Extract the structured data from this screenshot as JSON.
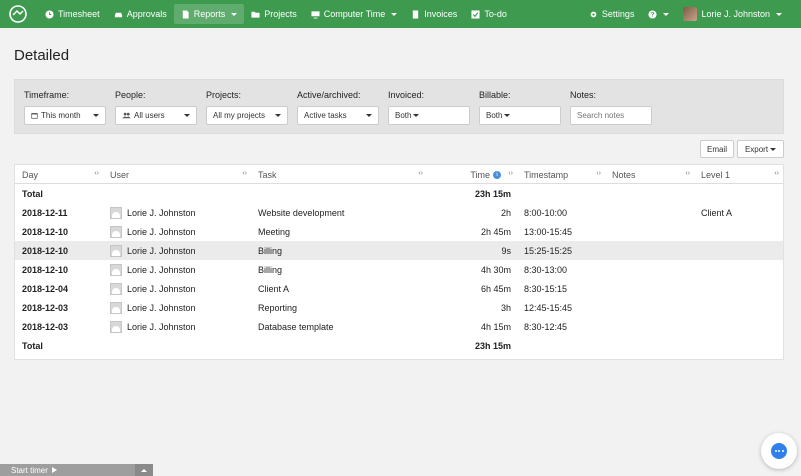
{
  "nav": {
    "items": [
      {
        "label": "Timesheet",
        "icon": "clock-icon"
      },
      {
        "label": "Approvals",
        "icon": "car-icon"
      },
      {
        "label": "Reports",
        "icon": "document-icon"
      },
      {
        "label": "Projects",
        "icon": "folder-icon"
      },
      {
        "label": "Computer Time",
        "icon": "monitor-icon"
      },
      {
        "label": "Invoices",
        "icon": "invoice-icon"
      },
      {
        "label": "To-do",
        "icon": "checkbox-icon"
      }
    ],
    "settings": "Settings",
    "help_icon": "question-icon",
    "user": "Lorie J. Johnston",
    "colors": {
      "bar": "#3d9a4f"
    }
  },
  "page": {
    "title": "Detailed"
  },
  "filters": {
    "timeframe": {
      "label": "Timeframe:",
      "value": "This month"
    },
    "people": {
      "label": "People:",
      "value": "All users"
    },
    "projects": {
      "label": "Projects:",
      "value": "All my projects"
    },
    "active": {
      "label": "Active/archived:",
      "value": "Active tasks"
    },
    "invoiced": {
      "label": "Invoiced:",
      "value": "Both"
    },
    "billable": {
      "label": "Billable:",
      "value": "Both"
    },
    "notes": {
      "label": "Notes:",
      "placeholder": "Search notes"
    }
  },
  "actions": {
    "email": "Email",
    "export": "Export"
  },
  "table": {
    "headers": {
      "day": "Day",
      "user": "User",
      "task": "Task",
      "time": "Time",
      "timestamp": "Timestamp",
      "notes": "Notes",
      "level1": "Level 1"
    },
    "total_label": "Total",
    "total_time": "23h 15m",
    "rows": [
      {
        "day": "2018-12-11",
        "user": "Lorie J. Johnston",
        "task": "Website development",
        "time": "2h",
        "timestamp": "8:00-10:00",
        "notes": "",
        "level1": "Client A"
      },
      {
        "day": "2018-12-10",
        "user": "Lorie J. Johnston",
        "task": "Meeting",
        "time": "2h 45m",
        "timestamp": "13:00-15:45",
        "notes": "",
        "level1": ""
      },
      {
        "day": "2018-12-10",
        "user": "Lorie J. Johnston",
        "task": "Billing",
        "time": "9s",
        "timestamp": "15:25-15:25",
        "notes": "",
        "level1": ""
      },
      {
        "day": "2018-12-10",
        "user": "Lorie J. Johnston",
        "task": "Billing",
        "time": "4h 30m",
        "timestamp": "8:30-13:00",
        "notes": "",
        "level1": ""
      },
      {
        "day": "2018-12-04",
        "user": "Lorie J. Johnston",
        "task": "Client A",
        "time": "6h 45m",
        "timestamp": "8:30-15:15",
        "notes": "",
        "level1": ""
      },
      {
        "day": "2018-12-03",
        "user": "Lorie J. Johnston",
        "task": "Reporting",
        "time": "3h",
        "timestamp": "12:45-15:45",
        "notes": "",
        "level1": ""
      },
      {
        "day": "2018-12-03",
        "user": "Lorie J. Johnston",
        "task": "Database template",
        "time": "4h 15m",
        "timestamp": "8:30-12:45",
        "notes": "",
        "level1": ""
      }
    ]
  },
  "footer": {
    "start_timer": "Start timer"
  }
}
